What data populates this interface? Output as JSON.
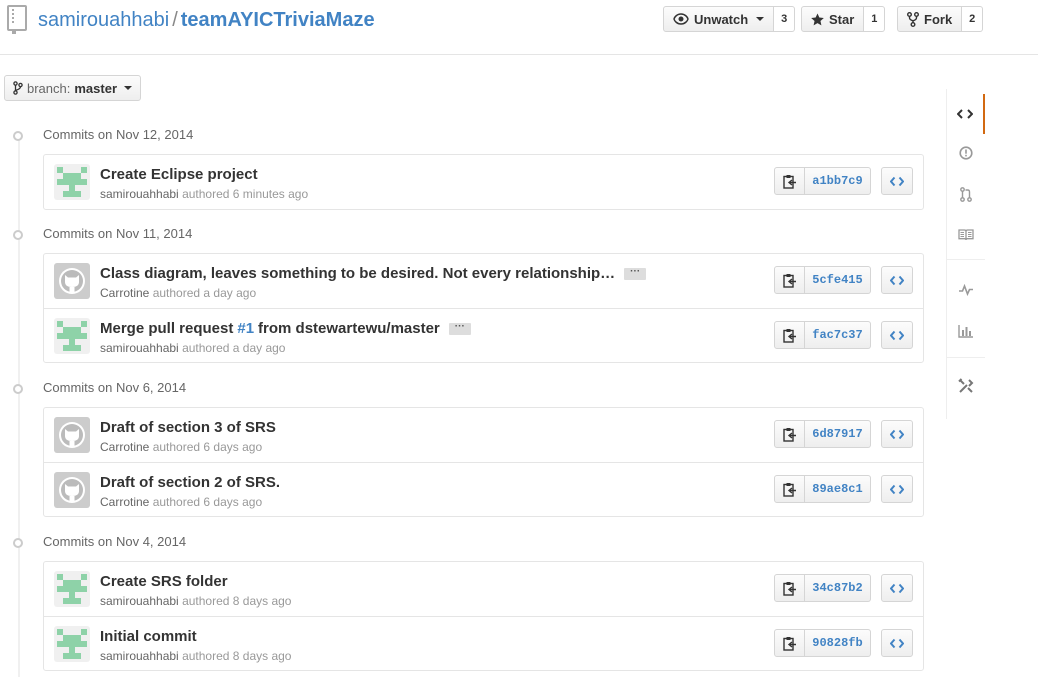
{
  "repo": {
    "owner": "samirouahhabi",
    "separator": "/",
    "name": "teamAYICTriviaMaze"
  },
  "actions": {
    "watch": {
      "label": "Unwatch",
      "count": "3",
      "icon": "eye-icon"
    },
    "star": {
      "label": "Star",
      "count": "1",
      "icon": "star-icon"
    },
    "fork": {
      "label": "Fork",
      "count": "2",
      "icon": "fork-icon"
    }
  },
  "branch": {
    "prefix": "branch:",
    "name": "master"
  },
  "groups": [
    {
      "title": "Commits on Nov 12, 2014",
      "commits": [
        {
          "title": "Create Eclipse project",
          "author": "samirouahhabi",
          "meta": "authored 6 minutes ago",
          "sha": "a1bb7c9",
          "avatar": "identicon"
        }
      ]
    },
    {
      "title": "Commits on Nov 11, 2014",
      "commits": [
        {
          "title": "Class diagram, leaves something to be desired. Not every relationship…",
          "author": "Carrotine",
          "meta": "authored a day ago",
          "sha": "5cfe415",
          "avatar": "octocat",
          "ellipsis": "···"
        },
        {
          "title_pre": "Merge pull request",
          "issue": "#1",
          "title_post": "from dstewartewu/master",
          "author": "samirouahhabi",
          "meta": "authored a day ago",
          "sha": "fac7c37",
          "avatar": "identicon",
          "ellipsis": "···"
        }
      ]
    },
    {
      "title": "Commits on Nov 6, 2014",
      "commits": [
        {
          "title": "Draft of section 3 of SRS",
          "author": "Carrotine",
          "meta": "authored 6 days ago",
          "sha": "6d87917",
          "avatar": "octocat"
        },
        {
          "title": "Draft of section 2 of SRS.",
          "author": "Carrotine",
          "meta": "authored 6 days ago",
          "sha": "89ae8c1",
          "avatar": "octocat"
        }
      ]
    },
    {
      "title": "Commits on Nov 4, 2014",
      "commits": [
        {
          "title": "Create SRS folder",
          "author": "samirouahhabi",
          "meta": "authored 8 days ago",
          "sha": "34c87b2",
          "avatar": "identicon"
        },
        {
          "title": "Initial commit",
          "author": "samirouahhabi",
          "meta": "authored 8 days ago",
          "sha": "90828fb",
          "avatar": "identicon"
        }
      ]
    }
  ],
  "side_nav": [
    "code-icon",
    "issues-icon",
    "pull-requests-icon",
    "wiki-icon",
    "pulse-icon",
    "graphs-icon",
    "settings-icon"
  ],
  "colors": {
    "link": "#4183c4",
    "identicon": "#8ed2a8",
    "accent": "#d26911"
  }
}
